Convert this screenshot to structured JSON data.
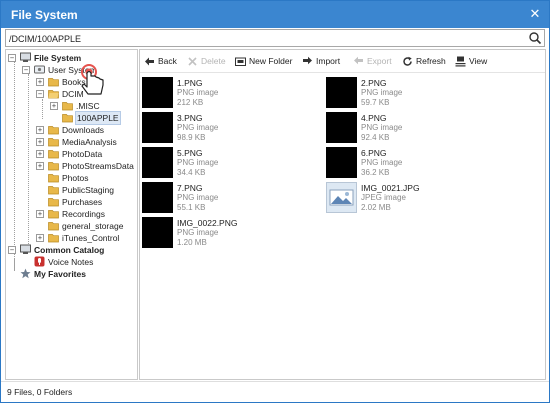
{
  "window": {
    "title": "File System",
    "close_glyph": "✕"
  },
  "path": {
    "value": "/DCIM/100APPLE",
    "search_icon": "search-icon"
  },
  "tree": {
    "root_label": "File System",
    "user_system_label": "User System",
    "books_label": "Books",
    "dcim_label": "DCIM",
    "misc_label": ".MISC",
    "apple_label": "100APPLE",
    "downloads_label": "Downloads",
    "media_label": "MediaAnalysis",
    "photodata_label": "PhotoData",
    "photostreams_label": "PhotoStreamsData",
    "photos_label": "Photos",
    "publicstaging_label": "PublicStaging",
    "purchases_label": "Purchases",
    "recordings_label": "Recordings",
    "general_label": "general_storage",
    "itunes_label": "iTunes_Control",
    "common_label": "Common Catalog",
    "voice_label": "Voice Notes",
    "favorites_label": "My Favorites"
  },
  "toolbar": {
    "back": "Back",
    "delete": "Delete",
    "new_folder": "New Folder",
    "import": "Import",
    "export": "Export",
    "refresh": "Refresh",
    "view": "View"
  },
  "files": [
    {
      "name": "1.PNG",
      "type": "PNG image",
      "size": "212 KB"
    },
    {
      "name": "2.PNG",
      "type": "PNG image",
      "size": "59.7 KB"
    },
    {
      "name": "3.PNG",
      "type": "PNG image",
      "size": "98.9 KB"
    },
    {
      "name": "4.PNG",
      "type": "PNG image",
      "size": "92.4 KB"
    },
    {
      "name": "5.PNG",
      "type": "PNG image",
      "size": "34.4 KB"
    },
    {
      "name": "6.PNG",
      "type": "PNG image",
      "size": "36.2 KB"
    },
    {
      "name": "7.PNG",
      "type": "PNG image",
      "size": "55.1 KB"
    },
    {
      "name": "IMG_0021.JPG",
      "type": "JPEG image",
      "size": "2.02 MB"
    },
    {
      "name": "IMG_0022.PNG",
      "type": "PNG image",
      "size": "1.20 MB"
    }
  ],
  "status": {
    "text": "9 Files, 0 Folders"
  },
  "colors": {
    "titlebar": "#3b86d0",
    "folder": "#e8b84a",
    "selection": "#dde8f5"
  }
}
